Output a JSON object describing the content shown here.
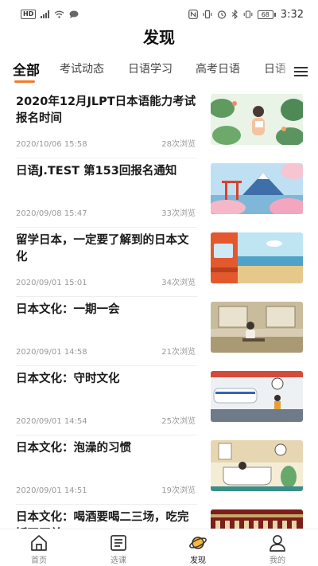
{
  "status_bar": {
    "left_badge": "HD",
    "battery": "68",
    "time": "3:32"
  },
  "page_title": "发现",
  "tabs": [
    {
      "label": "全部",
      "active": true
    },
    {
      "label": "考试动态",
      "active": false
    },
    {
      "label": "日语学习",
      "active": false
    },
    {
      "label": "高考日语",
      "active": false
    },
    {
      "label": "日语",
      "active": false
    }
  ],
  "articles": [
    {
      "title": "2020年12月JLPT日本语能力考试报名时间",
      "date": "2020/10/06 15:58",
      "views": "28次浏览",
      "thumb": "woman-reading-plants"
    },
    {
      "title": "日语J.TEST 第153回报名通知",
      "date": "2020/09/08 15:47",
      "views": "33次浏览",
      "thumb": "mount-fuji-sakura"
    },
    {
      "title": "留学日本，一定要了解到的日本文化",
      "date": "2020/09/01 15:01",
      "views": "34次浏览",
      "thumb": "train-seaside"
    },
    {
      "title": "日本文化：一期一会",
      "date": "2020/09/01 14:58",
      "views": "21次浏览",
      "thumb": "tea-room"
    },
    {
      "title": "日本文化：守时文化",
      "date": "2020/09/01 14:54",
      "views": "25次浏览",
      "thumb": "station-running"
    },
    {
      "title": "日本文化：泡澡的习惯",
      "date": "2020/09/01 14:51",
      "views": "19次浏览",
      "thumb": "bathroom"
    },
    {
      "title": "日本文化：喝酒要喝二三场，吃完饭再买单",
      "date": "",
      "views": "",
      "thumb": "izakaya"
    }
  ],
  "bottom_nav": [
    {
      "label": "首页",
      "icon": "home-icon",
      "active": false
    },
    {
      "label": "选课",
      "icon": "course-list-icon",
      "active": false
    },
    {
      "label": "发现",
      "icon": "planet-icon",
      "active": true
    },
    {
      "label": "我的",
      "icon": "user-icon",
      "active": false
    }
  ],
  "colors": {
    "accent": "#f07d2c",
    "text": "#1a1a1a",
    "muted": "#999999"
  }
}
